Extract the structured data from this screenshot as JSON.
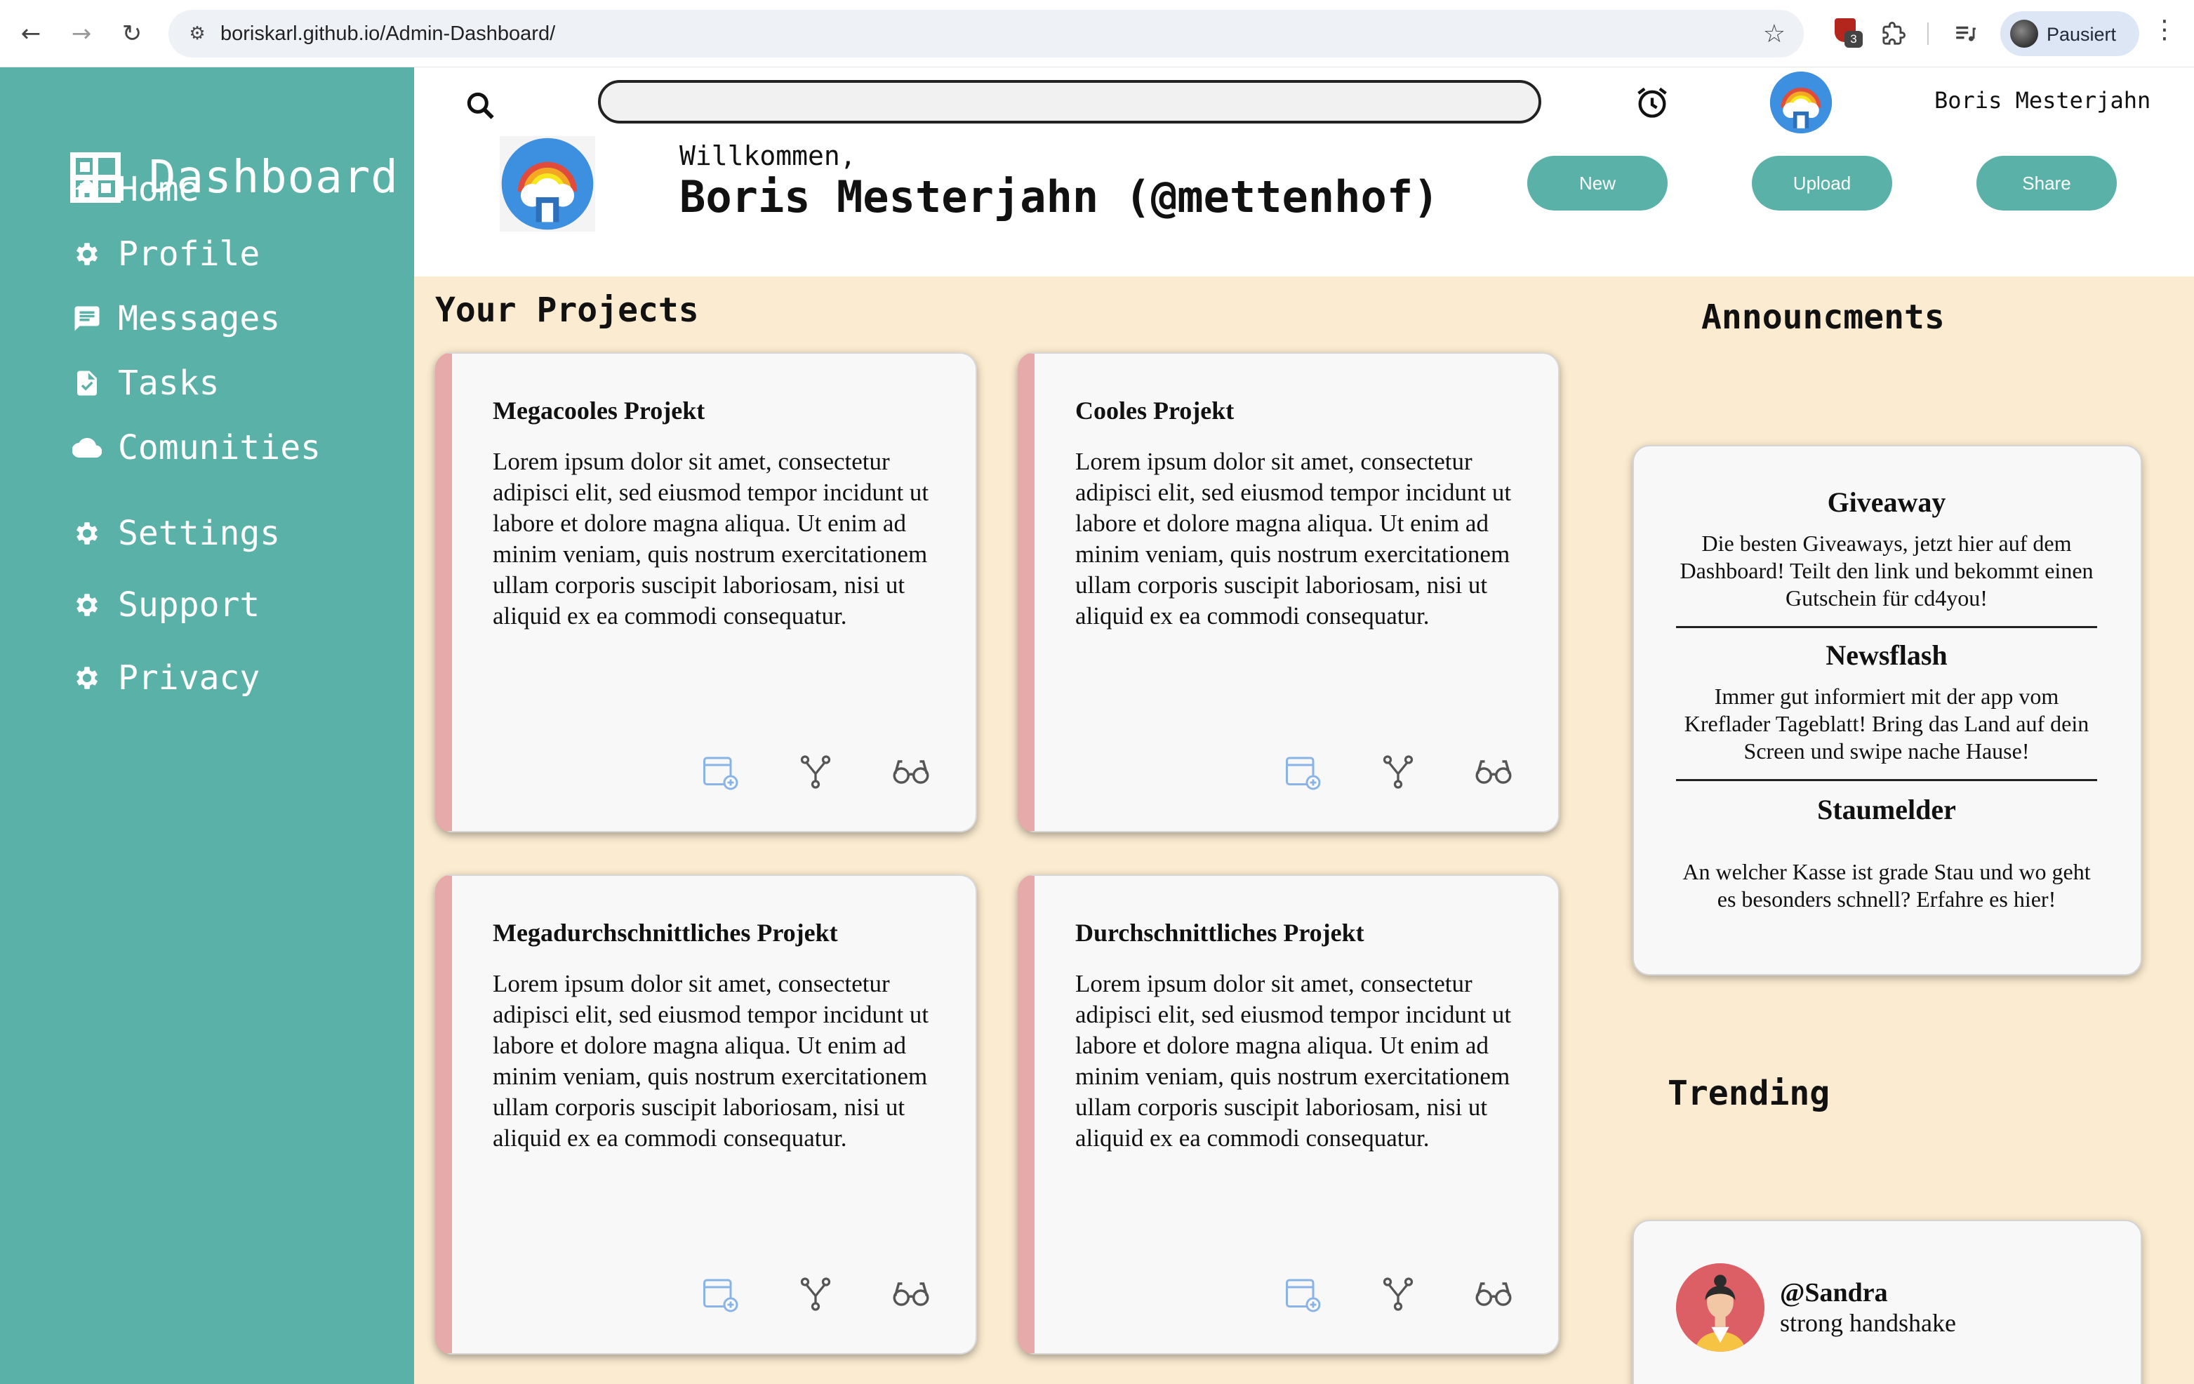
{
  "browser": {
    "url": "boriskarl.github.io/Admin-Dashboard/",
    "extension_badge_count": "3",
    "profile_label": "Pausiert"
  },
  "sidebar": {
    "brand": "Dashboard",
    "items": [
      {
        "label": "Home",
        "icon": "home-icon"
      },
      {
        "label": "Profile",
        "icon": "gear-icon"
      },
      {
        "label": "Messages",
        "icon": "message-icon"
      },
      {
        "label": "Tasks",
        "icon": "task-icon"
      },
      {
        "label": "Comunities",
        "icon": "cloud-icon"
      },
      {
        "label": "Settings",
        "icon": "gear-icon"
      },
      {
        "label": "Support",
        "icon": "gear-icon"
      },
      {
        "label": "Privacy",
        "icon": "gear-icon"
      }
    ]
  },
  "header": {
    "search_value": "",
    "user_name": "Boris Mesterjahn",
    "welcome": "Willkommen,",
    "full_name": "Boris Mesterjahn (@mettenhof)",
    "buttons": {
      "new": "New",
      "upload": "Upload",
      "share": "Share"
    }
  },
  "projects": {
    "title": "Your Projects",
    "cards": [
      {
        "title": "Megacooles Projekt",
        "body": "Lorem ipsum dolor sit amet, consectetur adipisci elit, sed eiusmod tempor incidunt ut labore et dolore magna aliqua. Ut enim ad minim veniam, quis nostrum exercitationem ullam corporis suscipit laboriosam, nisi ut aliquid ex ea commodi consequatur."
      },
      {
        "title": "Cooles Projekt",
        "body": "Lorem ipsum dolor sit amet, consectetur adipisci elit, sed eiusmod tempor incidunt ut labore et dolore magna aliqua. Ut enim ad minim veniam, quis nostrum exercitationem ullam corporis suscipit laboriosam, nisi ut aliquid ex ea commodi consequatur."
      },
      {
        "title": "Megadurchschnittliches Projekt",
        "body": "Lorem ipsum dolor sit amet, consectetur adipisci elit, sed eiusmod tempor incidunt ut labore et dolore magna aliqua. Ut enim ad minim veniam, quis nostrum exercitationem ullam corporis suscipit laboriosam, nisi ut aliquid ex ea commodi consequatur."
      },
      {
        "title": "Durchschnittliches Projekt",
        "body": "Lorem ipsum dolor sit amet, consectetur adipisci elit, sed eiusmod tempor incidunt ut labore et dolore magna aliqua. Ut enim ad minim veniam, quis nostrum exercitationem ullam corporis suscipit laboriosam, nisi ut aliquid ex ea commodi consequatur."
      }
    ]
  },
  "announcements": {
    "title": "Announcments",
    "items": [
      {
        "title": "Giveaway",
        "text": "Die besten Giveaways, jetzt hier auf dem Dashboard! Teilt den link und bekommt einen Gutschein für cd4you!"
      },
      {
        "title": "Newsflash",
        "text": "Immer gut informiert mit der app vom Kreflader Tageblatt! Bring das Land auf dein Screen und swipe nache Hause!"
      },
      {
        "title": "Staumelder",
        "text": "An welcher Kasse ist grade Stau und wo geht es besonders schnell? Erfahre es hier!"
      }
    ]
  },
  "trending": {
    "title": "Trending",
    "items": [
      {
        "user": "@Sandra",
        "text": "strong handshake"
      }
    ]
  },
  "colors": {
    "accent": "#5ab1a8",
    "main_bg": "#fbebd0",
    "card_stripe": "#e6aaaa"
  }
}
